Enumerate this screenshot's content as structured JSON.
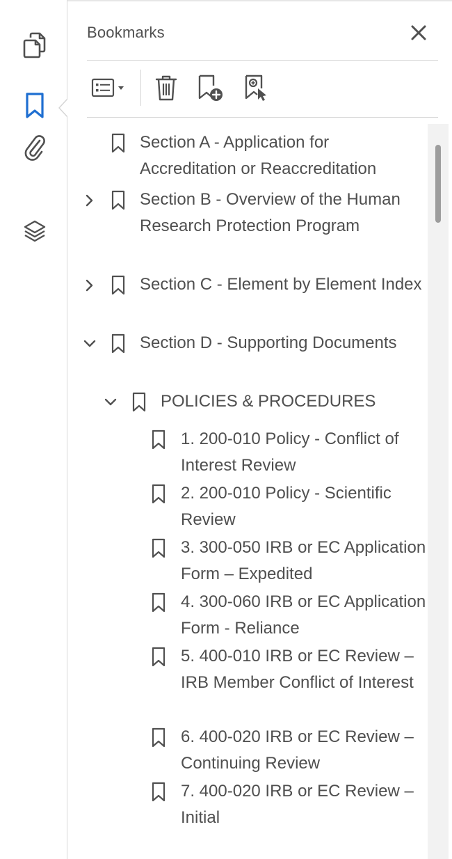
{
  "panel": {
    "title": "Bookmarks"
  },
  "left_toolbar": {
    "icons": [
      "page-thumbnails-icon",
      "bookmark-icon",
      "attachment-paperclip-icon",
      "layers-icon"
    ],
    "active": "bookmark-icon",
    "accent_color": "#1f6fd1",
    "icon_color": "#505050"
  },
  "toolbar": {
    "icons": [
      "options-list-icon",
      "dropdown-caret-icon",
      "trash-icon",
      "new-bookmark-icon",
      "add-bookmark-selection-icon"
    ]
  },
  "bookmarks": [
    {
      "label": "Section A - Application for Accreditation or Reaccreditation",
      "level": 0,
      "expander": "none"
    },
    {
      "label": "Section B - Overview of the Human Research Protection Program",
      "level": 0,
      "expander": "collapsed"
    },
    {
      "label": "Section C - Element by Element Index",
      "level": 0,
      "expander": "collapsed"
    },
    {
      "label": "Section D - Supporting Documents",
      "level": 0,
      "expander": "expanded"
    },
    {
      "label": "POLICIES & PROCEDURES",
      "level": 1,
      "expander": "expanded"
    },
    {
      "label": "1. 200-010 Policy - Conflict of Interest Review",
      "level": 2,
      "expander": "none"
    },
    {
      "label": "2. 200-010 Policy - Scientific Review",
      "level": 2,
      "expander": "none"
    },
    {
      "label": "3. 300-050 IRB or EC Application Form – Expedited",
      "level": 2,
      "expander": "none"
    },
    {
      "label": "4. 300-060 IRB or EC Application Form - Reliance",
      "level": 2,
      "expander": "none"
    },
    {
      "label": "5. 400-010 IRB or EC Review – IRB Member Conflict of Interest",
      "level": 2,
      "expander": "none"
    },
    {
      "label": "6. 400-020 IRB or EC Review – Continuing Review",
      "level": 2,
      "expander": "none"
    },
    {
      "label": "7. 400-020 IRB or EC Review – Initial",
      "level": 2,
      "expander": "none"
    }
  ]
}
